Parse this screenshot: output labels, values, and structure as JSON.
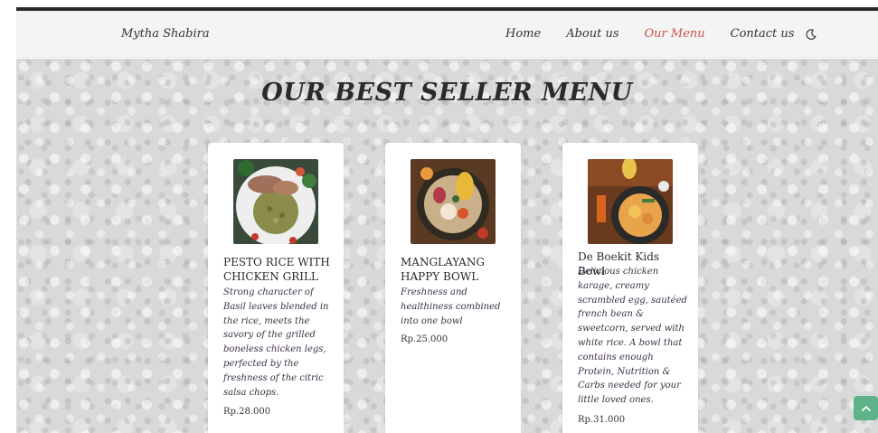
{
  "navbar": {
    "brand": "Mytha Shabira",
    "links": [
      {
        "label": "Home"
      },
      {
        "label": "About us"
      },
      {
        "label": "Our Menu"
      },
      {
        "label": "Contact us"
      }
    ],
    "active_link_color": "#c9544c",
    "theme_toggle_icon": "moon-icon"
  },
  "main": {
    "title": "OUR BEST SELLER MENU",
    "menu_items": [
      {
        "name": "PESTO RICE WITH CHICKEN GRILL",
        "description": "Strong character of Basil leaves blended in the rice, meets the savory of the grilled boneless chicken legs, perfected by the freshness of the citric salsa chops.",
        "price": "Rp.28.000"
      },
      {
        "name": "MANGLAYANG HAPPY BOWL",
        "description": "Freshness and healthiness combined into one bowl",
        "price": "Rp.25.000"
      },
      {
        "name": "De Boekit Kids Bowl",
        "description": "Delicious chicken karage, creamy scrambled egg, sautéed french bean & sweetcorn, served with white rice. A bowl that contains enough Protein, Nutrition & Carbs needed for your little loved ones.",
        "price": "Rp.31.000"
      }
    ]
  },
  "scroll_top": {
    "icon": "chevron-up-icon",
    "color": "#5fb38a"
  }
}
